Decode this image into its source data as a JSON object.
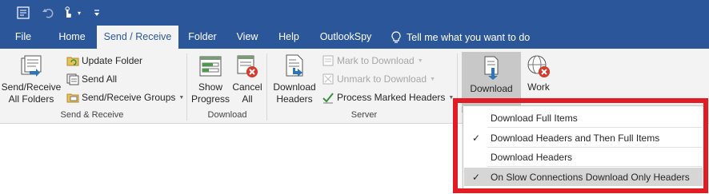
{
  "quick_access": {
    "icons": [
      "send-receive-all-icon",
      "undo-icon",
      "touch-mode-icon",
      "customize-qat-icon"
    ]
  },
  "tabs": [
    {
      "label": "File"
    },
    {
      "label": "Home"
    },
    {
      "label": "Send / Receive"
    },
    {
      "label": "Folder"
    },
    {
      "label": "View"
    },
    {
      "label": "Help"
    },
    {
      "label": "OutlookSpy"
    }
  ],
  "tell_me": "Tell me what you want to do",
  "groups": {
    "send_receive": {
      "label": "Send & Receive",
      "all_folders_line1": "Send/Receive",
      "all_folders_line2": "All Folders",
      "update_folder": "Update Folder",
      "send_all": "Send All",
      "groups_btn": "Send/Receive Groups"
    },
    "download": {
      "label": "Download",
      "show_progress_line1": "Show",
      "show_progress_line2": "Progress",
      "cancel_all_line1": "Cancel",
      "cancel_all_line2": "All"
    },
    "server": {
      "label": "Server",
      "download_headers_line1": "Download",
      "download_headers_line2": "Headers",
      "mark_to_download": "Mark to Download",
      "unmark_to_download": "Unmark to Download",
      "process_marked_headers": "Process Marked Headers"
    },
    "preferences": {
      "download_pref_line1": "Download",
      "work_offline_line1": "Work"
    }
  },
  "dropdown": {
    "items": [
      {
        "label": "Download Full Items",
        "checked": false,
        "highlighted": false
      },
      {
        "label": "Download Headers and Then Full Items",
        "checked": true,
        "highlighted": false
      },
      {
        "label": "Download Headers",
        "checked": false,
        "highlighted": false
      },
      {
        "label": "On Slow Connections Download Only Headers",
        "checked": true,
        "highlighted": true
      }
    ],
    "check_glyph": "✓"
  },
  "colors": {
    "title_bar": "#2b579a",
    "ribbon": "#f3f3f3",
    "highlight_frame": "#e21c24"
  }
}
